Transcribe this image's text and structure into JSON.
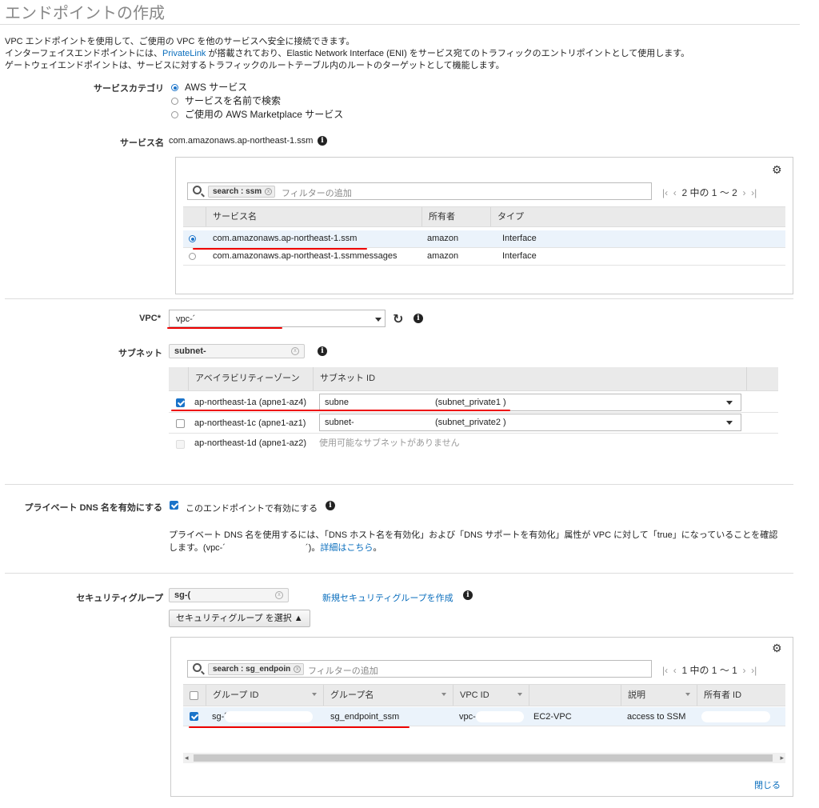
{
  "title": "エンドポイントの作成",
  "intro": {
    "line1": "VPC エンドポイントを使用して、ご使用の VPC を他のサービスへ安全に接続できます。",
    "line2_pre": "インターフェイスエンドポイントには、",
    "line2_link": "PrivateLink",
    "line2_post": " が搭載されており、Elastic Network Interface (ENI) をサービス宛てのトラフィックのエントリポイントとして使用します。",
    "line3": "ゲートウェイエンドポイントは、サービスに対するトラフィックのルートテーブル内のルートのターゲットとして機能します。"
  },
  "service_category": {
    "label": "サービスカテゴリ",
    "options": [
      "AWS サービス",
      "サービスを名前で検索",
      "ご使用の AWS Marketplace サービス"
    ],
    "selected_index": 0
  },
  "service_name": {
    "label": "サービス名",
    "value": "com.amazonaws.ap-northeast-1.ssm"
  },
  "services_table": {
    "search_token": "search : ssm",
    "placeholder": "フィルターの追加",
    "pager": "2 中の 1 ～ 2",
    "headers": [
      "サービス名",
      "所有者",
      "タイプ"
    ],
    "rows": [
      {
        "name": "com.amazonaws.ap-northeast-1.ssm",
        "owner": "amazon",
        "type": "Interface",
        "selected": true
      },
      {
        "name": "com.amazonaws.ap-northeast-1.ssmmessages",
        "owner": "amazon",
        "type": "Interface",
        "selected": false
      }
    ]
  },
  "vpc": {
    "label": "VPC*",
    "value": "vpc-´"
  },
  "subnet": {
    "label": "サブネット",
    "filter": "subnet-",
    "headers": [
      "アベイラビリティーゾーン",
      "サブネット ID"
    ],
    "rows": [
      {
        "az": "ap-northeast-1a (apne1-az4)",
        "subnet": "subne",
        "subnet_name": "(subnet_private1 )",
        "checked": true,
        "disabled": false
      },
      {
        "az": "ap-northeast-1c (apne1-az1)",
        "subnet": "subnet-",
        "subnet_name": "(subnet_private2 )",
        "checked": false,
        "disabled": false
      },
      {
        "az": "ap-northeast-1d (apne1-az2)",
        "subnet": "使用可能なサブネットがありません",
        "subnet_name": "",
        "checked": false,
        "disabled": true
      }
    ]
  },
  "private_dns": {
    "label": "プライベート DNS 名を有効にする",
    "checkbox_label": "このエンドポイントで有効にする",
    "checked": true,
    "note1": "プライベート DNS 名を使用するには、「DNS ホスト名を有効化」および「DNS サポートを有効化」属性が VPC に対して「true」になっていることを確認",
    "note2_pre": "します。(vpc-´",
    "note2_mid": "´)。",
    "note2_link": "詳細はこちら",
    "note2_post": "。"
  },
  "security_group": {
    "label": "セキュリティグループ",
    "filter": "sg-(",
    "create_link": "新規セキュリティグループを作成",
    "select_button": "セキュリティグループ を選択 ▲",
    "search_token": "search : sg_endpoin",
    "placeholder": "フィルターの追加",
    "pager": "1 中の 1 ～ 1",
    "headers": [
      "グループ ID",
      "グループ名",
      "VPC ID",
      "",
      "説明",
      "所有者 ID"
    ],
    "rows": [
      {
        "group_id": "sg-´",
        "group_name": "sg_endpoint_ssm",
        "vpc_id": "vpc-",
        "vpc_name": "EC2-VPC",
        "description": "access to SSM",
        "owner_id": "",
        "checked": true
      }
    ],
    "close_link": "閉じる"
  },
  "colors": {
    "accent": "#1a73c9",
    "link": "#0a6ebd",
    "annotation_red": "#e00000",
    "selected_row": "#ebf3fb"
  }
}
